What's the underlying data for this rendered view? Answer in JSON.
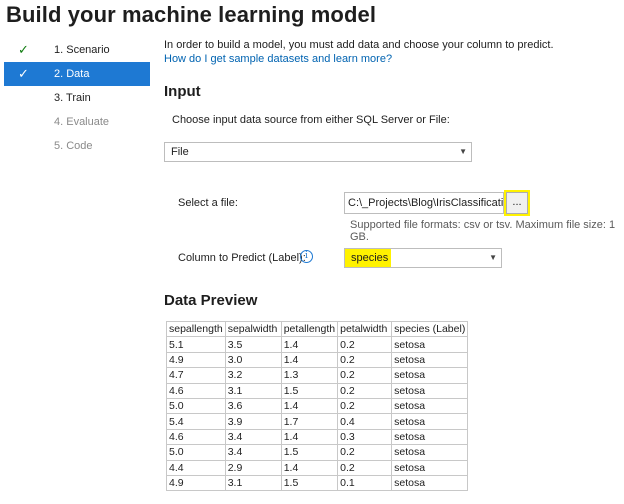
{
  "title": "Build your machine learning model",
  "steps": [
    {
      "label": "1. Scenario",
      "checked": true
    },
    {
      "label": "2. Data",
      "checked": true,
      "active": true
    },
    {
      "label": "3. Train"
    },
    {
      "label": "4. Evaluate",
      "disabled": true
    },
    {
      "label": "5. Code",
      "disabled": true
    }
  ],
  "intro": "In order to build a model, you must add data and choose your column to predict.",
  "help_link": "How do I get sample datasets and learn more?",
  "input": {
    "heading": "Input",
    "source_prompt": "Choose input data source from either SQL Server or File:",
    "source_value": "File",
    "select_file_label": "Select a file:",
    "file_path": "C:\\_Projects\\Blog\\IrisClassification",
    "browse_label": "...",
    "formats_note": "Supported file formats: csv or tsv. Maximum file size: 1 GB.",
    "label_column_label": "Column to Predict (Label):",
    "label_column_value": "species"
  },
  "preview": {
    "heading": "Data Preview",
    "columns": [
      "sepallength",
      "sepalwidth",
      "petallength",
      "petalwidth",
      "species (Label)"
    ],
    "rows": [
      [
        "5.1",
        "3.5",
        "1.4",
        "0.2",
        "setosa"
      ],
      [
        "4.9",
        "3.0",
        "1.4",
        "0.2",
        "setosa"
      ],
      [
        "4.7",
        "3.2",
        "1.3",
        "0.2",
        "setosa"
      ],
      [
        "4.6",
        "3.1",
        "1.5",
        "0.2",
        "setosa"
      ],
      [
        "5.0",
        "3.6",
        "1.4",
        "0.2",
        "setosa"
      ],
      [
        "5.4",
        "3.9",
        "1.7",
        "0.4",
        "setosa"
      ],
      [
        "4.6",
        "3.4",
        "1.4",
        "0.3",
        "setosa"
      ],
      [
        "5.0",
        "3.4",
        "1.5",
        "0.2",
        "setosa"
      ],
      [
        "4.4",
        "2.9",
        "1.4",
        "0.2",
        "setosa"
      ],
      [
        "4.9",
        "3.1",
        "1.5",
        "0.1",
        "setosa"
      ]
    ]
  },
  "colors": {
    "accent": "#1e79d3",
    "check": "#107c10",
    "highlight": "#fff200",
    "link": "#0063b1"
  },
  "icons": {
    "check": "check-icon",
    "info": "info-icon",
    "dropdown": "chevron-down-icon"
  }
}
